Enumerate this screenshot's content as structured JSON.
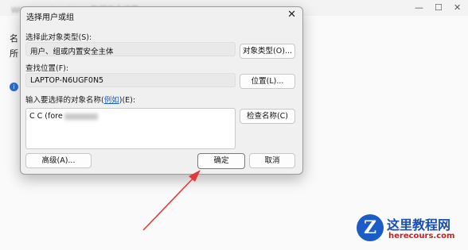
{
  "background": {
    "title": "Windows App Store 数据安全设置",
    "labels": [
      "名",
      "所"
    ]
  },
  "dialog": {
    "title": "选择用户或组",
    "object_type_label": "选择此对象类型(S):",
    "object_type_value": "用户、组或内置安全主体",
    "object_type_button": "对象类型(O)...",
    "location_label": "查找位置(F):",
    "location_value": "LAPTOP-N6UGF0N5",
    "location_button": "位置(L)...",
    "names_label_prefix": "输入要选择的对象名称(",
    "names_label_link": "例如",
    "names_label_suffix": ")(E):",
    "names_value": "C C (fore",
    "check_names_button": "检查名称(C)",
    "advanced_button": "高级(A)...",
    "ok_button": "确定",
    "cancel_button": "取消"
  },
  "watermark": {
    "logo_letter": "Z",
    "title": "这里教程网",
    "url": "herecours.com"
  },
  "colors": {
    "arrow": "#e03b3b",
    "link": "#1a5fc4",
    "watermark_blue": "#1b5cc6",
    "watermark_red": "#c61f1f"
  }
}
